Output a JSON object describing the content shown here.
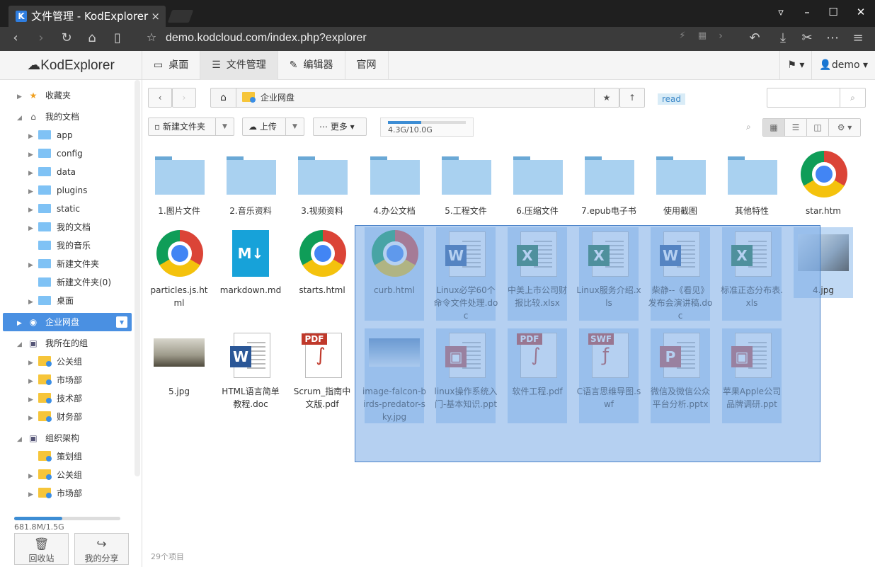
{
  "browser": {
    "tab_title": "文件管理 - KodExplorer",
    "tab_logo": "K",
    "url": "demo.kodcloud.com/index.php?explorer"
  },
  "app": {
    "logo": "KodExplorer",
    "nav": [
      "桌面",
      "文件管理",
      "编辑器",
      "官网"
    ],
    "user": "demo"
  },
  "sidebar": {
    "tree": [
      {
        "label": "收藏夹",
        "type": "star"
      },
      {
        "label": "我的文档",
        "type": "home"
      },
      {
        "label": "app",
        "type": "folder"
      },
      {
        "label": "config",
        "type": "folder"
      },
      {
        "label": "data",
        "type": "folder"
      },
      {
        "label": "plugins",
        "type": "folder"
      },
      {
        "label": "static",
        "type": "folder"
      },
      {
        "label": "我的文档",
        "type": "folder"
      },
      {
        "label": "我的音乐",
        "type": "folder"
      },
      {
        "label": "新建文件夹",
        "type": "folder"
      },
      {
        "label": "新建文件夹(0)",
        "type": "folder"
      },
      {
        "label": "桌面",
        "type": "folder"
      },
      {
        "label": "企业网盘",
        "type": "group-root"
      },
      {
        "label": "我所在的组",
        "type": "users"
      },
      {
        "label": "公关组",
        "type": "group"
      },
      {
        "label": "市场部",
        "type": "group"
      },
      {
        "label": "技术部",
        "type": "group"
      },
      {
        "label": "财务部",
        "type": "group"
      },
      {
        "label": "组织架构",
        "type": "org"
      },
      {
        "label": "策划组",
        "type": "group"
      },
      {
        "label": "公关组",
        "type": "group"
      },
      {
        "label": "市场部",
        "type": "group"
      }
    ],
    "quota_text": "681.8M/1.5G",
    "quota_fraction": 0.45,
    "btn_recycle": "回收站",
    "btn_share": "我的分享"
  },
  "pathbar": {
    "crumb": "企业网盘",
    "tag": "read"
  },
  "toolbar": {
    "new_folder": "新建文件夹",
    "upload": "上传",
    "more": "更多",
    "space_text": "4.3G/10.0G",
    "space_fraction": 0.43
  },
  "files": [
    {
      "name": "1.图片文件",
      "kind": "folder"
    },
    {
      "name": "2.音乐资料",
      "kind": "folder"
    },
    {
      "name": "3.视频资料",
      "kind": "folder"
    },
    {
      "name": "4.办公文档",
      "kind": "folder"
    },
    {
      "name": "5.工程文件",
      "kind": "folder"
    },
    {
      "name": "6.压缩文件",
      "kind": "folder"
    },
    {
      "name": "7.epub电子书",
      "kind": "folder"
    },
    {
      "name": "使用截图",
      "kind": "folder"
    },
    {
      "name": "其他特性",
      "kind": "folder"
    },
    {
      "name": "star.htm",
      "kind": "chrome"
    },
    {
      "name": "particles.js.html",
      "kind": "chrome"
    },
    {
      "name": "markdown.md",
      "kind": "md"
    },
    {
      "name": "starts.html",
      "kind": "chrome"
    },
    {
      "name": "curb.html",
      "kind": "chrome"
    },
    {
      "name": "Linux必学60个命令文件处理.doc",
      "kind": "word"
    },
    {
      "name": "中美上市公司财报比较.xlsx",
      "kind": "excel"
    },
    {
      "name": "Linux服务介绍.xls",
      "kind": "excel"
    },
    {
      "name": "柴静--《看见》发布会演讲稿.doc",
      "kind": "word"
    },
    {
      "name": "标准正态分布表.xls",
      "kind": "excel"
    },
    {
      "name": "4.jpg",
      "kind": "photo-cat"
    },
    {
      "name": "5.jpg",
      "kind": "photo-field"
    },
    {
      "name": "HTML语言简单教程.doc",
      "kind": "word"
    },
    {
      "name": "Scrum_指南中文版.pdf",
      "kind": "pdf"
    },
    {
      "name": "image-falcon-birds-predator-sky.jpg",
      "kind": "photo-bird"
    },
    {
      "name": "linux操作系统入门-基本知识.ppt",
      "kind": "ppt"
    },
    {
      "name": "软件工程.pdf",
      "kind": "pdf"
    },
    {
      "name": "C语言思维导图.swf",
      "kind": "swf"
    },
    {
      "name": "微信及微信公众平台分析.pptx",
      "kind": "pptx"
    },
    {
      "name": "苹果Apple公司品牌调研.ppt",
      "kind": "ppt"
    }
  ],
  "status": "29个项目",
  "colors": {
    "accent": "#4a90e2",
    "selection": "#78aae6",
    "folder": "#a9d1f0"
  }
}
